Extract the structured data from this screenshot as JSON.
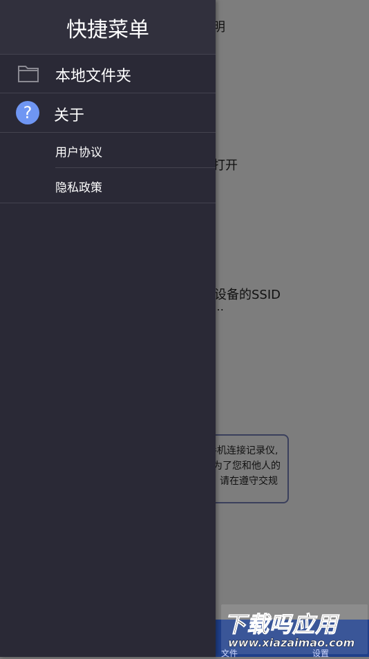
{
  "background": {
    "texts": [
      "明",
      "打开",
      "设备的SSID",
      "…"
    ],
    "notice_lines": [
      "手机连接记录仪,",
      "为了您和他人的",
      "请在遵守交规"
    ],
    "bottom_tabs": [
      "文件",
      "设置"
    ]
  },
  "drawer": {
    "title": "快捷菜单",
    "items": [
      {
        "label": "本地文件夹",
        "icon": "folder-icon"
      },
      {
        "label": "关于",
        "icon": "help-icon",
        "icon_glyph": "?"
      },
      {
        "label": "用户协议"
      },
      {
        "label": "隐私政策"
      }
    ]
  },
  "watermark": {
    "title": "下载吗应用",
    "url": "www.xiazaimao.com"
  },
  "colors": {
    "drawer_bg": "#2a2936",
    "header_bg": "#31303d",
    "accent_blue": "#6f96f3",
    "dim_overlay": "#7d7d7d"
  }
}
